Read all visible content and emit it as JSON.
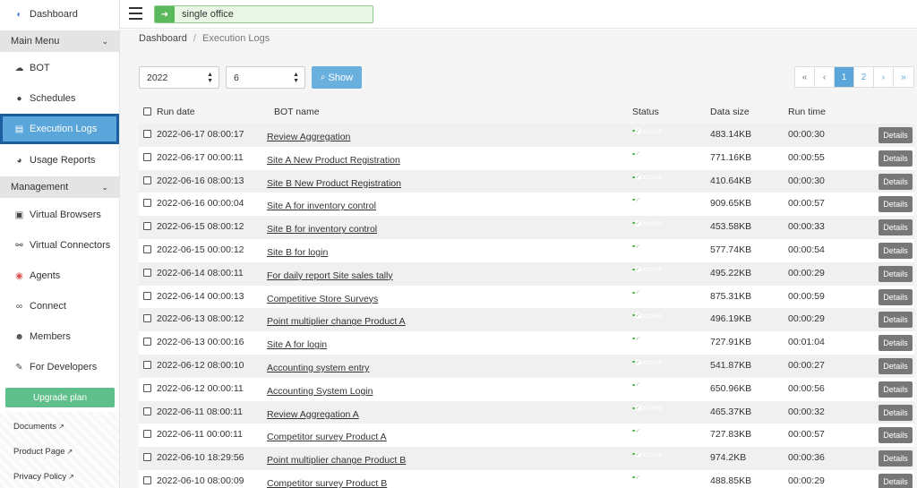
{
  "sidebar": {
    "dashboard": "Dashboard",
    "main_menu": "Main Menu",
    "items_main": [
      {
        "label": "BOT",
        "icon": "bot-icon"
      },
      {
        "label": "Schedules",
        "icon": "clock-icon"
      },
      {
        "label": "Execution Logs",
        "icon": "document-icon"
      },
      {
        "label": "Usage Reports",
        "icon": "pie-chart-icon"
      }
    ],
    "management": "Management",
    "items_management": [
      {
        "label": "Virtual Browsers",
        "icon": "browsers-icon"
      },
      {
        "label": "Virtual Connectors",
        "icon": "connector-icon"
      },
      {
        "label": "Agents",
        "icon": "agents-icon"
      },
      {
        "label": "Connect",
        "icon": "link-icon"
      },
      {
        "label": "Members",
        "icon": "users-icon"
      },
      {
        "label": "For Developers",
        "icon": "wrench-icon"
      }
    ],
    "upgrade": "Upgrade plan",
    "links": [
      "Documents",
      "Product Page",
      "Privacy Policy"
    ]
  },
  "topbar": {
    "office": "single office"
  },
  "breadcrumb": {
    "root": "Dashboard",
    "sep": "/",
    "current": "Execution Logs"
  },
  "filters": {
    "year": "2022",
    "month": "6",
    "show": "Show"
  },
  "pager": {
    "first": "«",
    "prev": "‹",
    "p1": "1",
    "p2": "2",
    "next": "›",
    "last": "»"
  },
  "table": {
    "headers": {
      "run_date": "Run date",
      "bot_name": "BOT name",
      "status": "Status",
      "data_size": "Data size",
      "run_time": "Run time"
    },
    "details_label": "Details",
    "rows": [
      {
        "date": "2022-06-17 08:00:17",
        "bot": "Review Aggregation",
        "status": "Success",
        "size": "483.14KB",
        "time": "00:00:30"
      },
      {
        "date": "2022-06-17 00:00:11",
        "bot": "Site A New Product Registration",
        "status": "Success",
        "size": "771.16KB",
        "time": "00:00:55"
      },
      {
        "date": "2022-06-16 08:00:13",
        "bot": "Site B New Product Registration",
        "status": "Success",
        "size": "410.64KB",
        "time": "00:00:30"
      },
      {
        "date": "2022-06-16 00:00:04",
        "bot": "Site A for inventory control",
        "status": "Success",
        "size": "909.65KB",
        "time": "00:00:57"
      },
      {
        "date": "2022-06-15 08:00:12",
        "bot": "Site B for inventory control",
        "status": "Success",
        "size": "453.58KB",
        "time": "00:00:33"
      },
      {
        "date": "2022-06-15 00:00:12",
        "bot": "Site B for login",
        "status": "Success",
        "size": "577.74KB",
        "time": "00:00:54"
      },
      {
        "date": "2022-06-14 08:00:11",
        "bot": "For daily report Site sales tally",
        "status": "Success",
        "size": "495.22KB",
        "time": "00:00:29"
      },
      {
        "date": "2022-06-14 00:00:13",
        "bot": "Competitive Store Surveys",
        "status": "Success",
        "size": "875.31KB",
        "time": "00:00:59"
      },
      {
        "date": "2022-06-13 08:00:12",
        "bot": "Point multiplier change Product A",
        "status": "Success",
        "size": "496.19KB",
        "time": "00:00:29"
      },
      {
        "date": "2022-06-13 00:00:16",
        "bot": "Site A for login",
        "status": "Success",
        "size": "727.91KB",
        "time": "00:01:04"
      },
      {
        "date": "2022-06-12 08:00:10",
        "bot": "Accounting system entry",
        "status": "Success",
        "size": "541.87KB",
        "time": "00:00:27"
      },
      {
        "date": "2022-06-12 00:00:11",
        "bot": "Accounting System Login",
        "status": "Success",
        "size": "650.96KB",
        "time": "00:00:56"
      },
      {
        "date": "2022-06-11 08:00:11",
        "bot": "Review Aggregation A",
        "status": "Success",
        "size": "465.37KB",
        "time": "00:00:32"
      },
      {
        "date": "2022-06-11 00:00:11",
        "bot": "Competitor survey Product A",
        "status": "Success",
        "size": "727.83KB",
        "time": "00:00:57"
      },
      {
        "date": "2022-06-10 18:29:56",
        "bot": "Point multiplier change Product B",
        "status": "Success",
        "size": "974.2KB",
        "time": "00:00:36"
      },
      {
        "date": "2022-06-10 08:00:09",
        "bot": "Competitor survey Product B",
        "status": "Success",
        "size": "488.85KB",
        "time": "00:00:29"
      }
    ]
  },
  "colors": {
    "accent": "#5aa6db",
    "active_border": "#1c5f9e",
    "success": "#5cb85c",
    "upgrade": "#5fbf8a"
  }
}
